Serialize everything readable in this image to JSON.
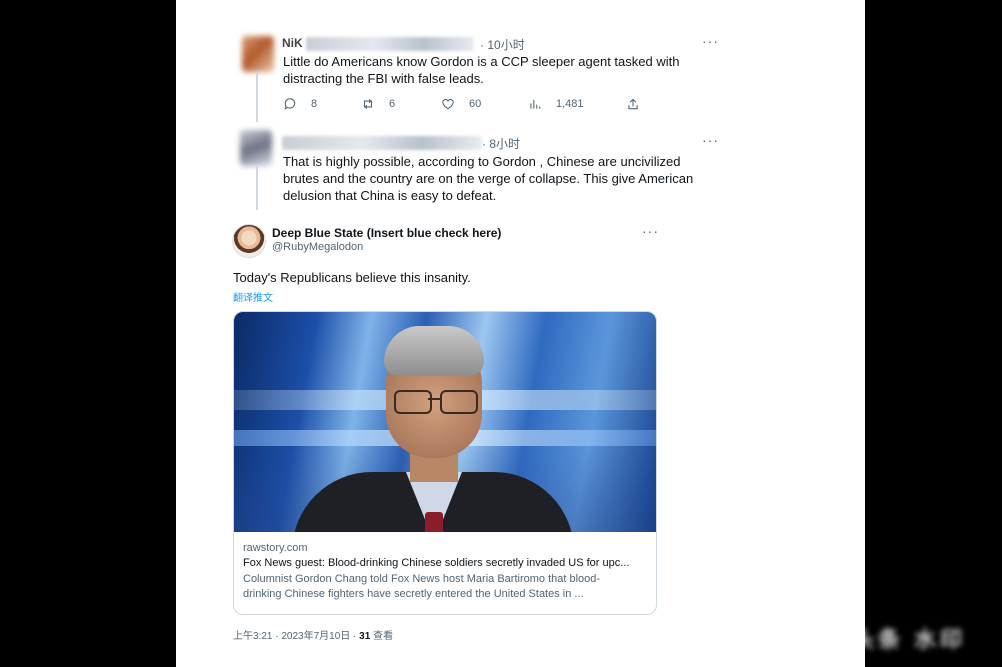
{
  "reply1": {
    "name_visible": "NiK",
    "time": "10小时",
    "text_line1": "Little do Americans know Gordon is a CCP sleeper agent tasked with",
    "text_line2": "distracting the FBI with false leads.",
    "actions": {
      "reply_count": "8",
      "retweet_count": "6",
      "like_count": "60",
      "views_count": "1,481"
    }
  },
  "reply2": {
    "time": "8小时",
    "text_line1": "That is highly possible, according to Gordon , Chinese are uncivilized",
    "text_line2": "brutes and the country are on the verge of collapse. This give American",
    "text_line3": "delusion that China is easy to defeat."
  },
  "main_tweet": {
    "display_name": "Deep Blue State (Insert blue check here)",
    "handle": "@RubyMegalodon",
    "text": "Today's Republicans believe this insanity.",
    "translate": "翻译推文",
    "card": {
      "domain": "rawstory.com",
      "title": "Fox News guest: Blood-drinking Chinese soldiers secretly invaded US for upc...",
      "desc_line1": "Columnist Gordon Chang told Fox News host Maria Bartiromo that blood-",
      "desc_line2": "drinking Chinese fighters have secretly entered the United States in ..."
    },
    "timestamp": "上午3:21 · 2023年7月10日 · ",
    "views_count": "31",
    "views_label": " 查看"
  },
  "more_icon": "···",
  "icons": [
    "reply-icon",
    "retweet-icon",
    "like-icon",
    "views-icon",
    "share-icon",
    "more-icon"
  ],
  "colors": {
    "link": "#1d9bf0",
    "muted": "#536471",
    "text": "#0f1419"
  }
}
